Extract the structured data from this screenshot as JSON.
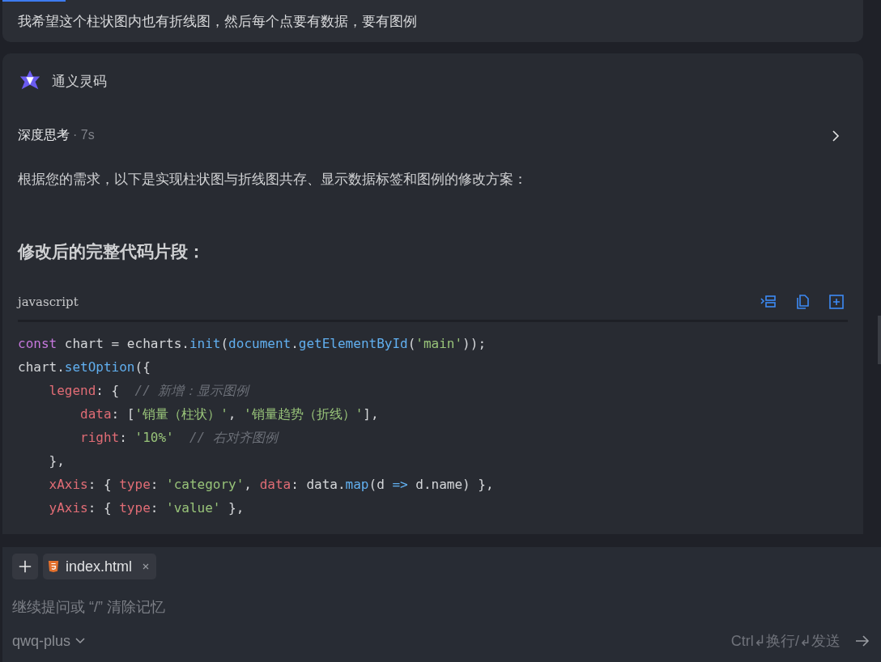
{
  "user_message": {
    "text": "我希望这个柱状图内也有折线图，然后每个点要有数据，要有图例"
  },
  "assistant": {
    "name": "通义灵码",
    "thinking": {
      "label": "深度思考",
      "duration": "· 7s",
      "expanded": false
    },
    "intro": "根据您的需求，以下是实现柱状图与折线图共存、显示数据标签和图例的修改方案：",
    "heading": "修改后的完整代码片段：",
    "code": {
      "language": "javascript",
      "lines": [
        [
          {
            "kind": "keyword",
            "t": "const"
          },
          {
            "kind": "plain",
            "t": " chart = echarts."
          },
          {
            "kind": "function",
            "t": "init"
          },
          {
            "kind": "plain",
            "t": "("
          },
          {
            "kind": "function",
            "t": "document"
          },
          {
            "kind": "plain",
            "t": "."
          },
          {
            "kind": "function",
            "t": "getElementById"
          },
          {
            "kind": "plain",
            "t": "("
          },
          {
            "kind": "string",
            "t": "'main'"
          },
          {
            "kind": "plain",
            "t": "));"
          }
        ],
        [
          {
            "kind": "plain",
            "t": "chart."
          },
          {
            "kind": "function",
            "t": "setOption"
          },
          {
            "kind": "plain",
            "t": "({"
          }
        ],
        [
          {
            "kind": "property",
            "t": "    legend"
          },
          {
            "kind": "plain",
            "t": ": {  "
          },
          {
            "kind": "comment",
            "t": "// 新增：显示图例"
          }
        ],
        [
          {
            "kind": "property",
            "t": "        data"
          },
          {
            "kind": "plain",
            "t": ": ["
          },
          {
            "kind": "string",
            "t": "'销量（柱状）'"
          },
          {
            "kind": "plain",
            "t": ", "
          },
          {
            "kind": "string",
            "t": "'销量趋势（折线）'"
          },
          {
            "kind": "plain",
            "t": "],"
          }
        ],
        [
          {
            "kind": "property",
            "t": "        right"
          },
          {
            "kind": "plain",
            "t": ": "
          },
          {
            "kind": "string",
            "t": "'10%'"
          },
          {
            "kind": "comment",
            "t": "  // 右对齐图例"
          }
        ],
        [
          {
            "kind": "plain",
            "t": "    },"
          }
        ],
        [
          {
            "kind": "property",
            "t": "    xAxis"
          },
          {
            "kind": "plain",
            "t": ": { "
          },
          {
            "kind": "property",
            "t": "type"
          },
          {
            "kind": "plain",
            "t": ": "
          },
          {
            "kind": "string",
            "t": "'category'"
          },
          {
            "kind": "plain",
            "t": ", "
          },
          {
            "kind": "property",
            "t": "data"
          },
          {
            "kind": "plain",
            "t": ": data."
          },
          {
            "kind": "function",
            "t": "map"
          },
          {
            "kind": "plain",
            "t": "(d "
          },
          {
            "kind": "function",
            "t": "=>"
          },
          {
            "kind": "plain",
            "t": " d.name) },"
          }
        ],
        [
          {
            "kind": "property",
            "t": "    yAxis"
          },
          {
            "kind": "plain",
            "t": ": { "
          },
          {
            "kind": "property",
            "t": "type"
          },
          {
            "kind": "plain",
            "t": ": "
          },
          {
            "kind": "string",
            "t": "'value'"
          },
          {
            "kind": "plain",
            "t": " },"
          }
        ]
      ]
    }
  },
  "composer": {
    "attachment": "index.html",
    "placeholder": "继续提问或 “/” 清除记忆",
    "model": "qwq-plus",
    "hint": "Ctrl↲换行/↲发送"
  }
}
